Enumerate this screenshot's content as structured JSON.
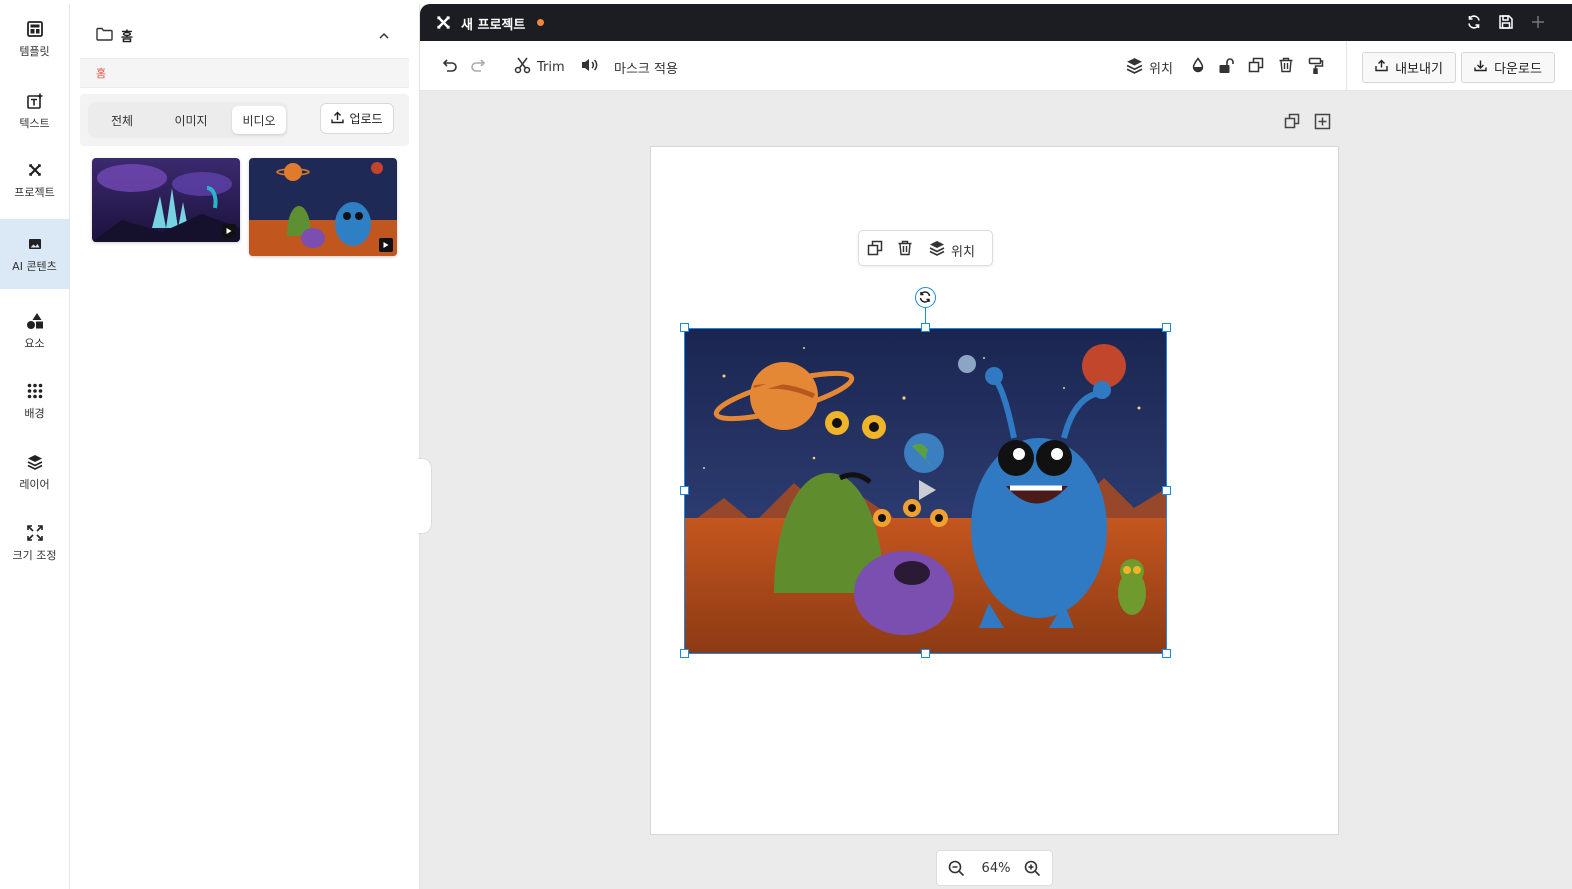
{
  "rail": {
    "items": [
      {
        "label": "템플릿",
        "icon": "template-icon"
      },
      {
        "label": "텍스트",
        "icon": "add-text-icon"
      },
      {
        "label": "프로젝트",
        "icon": "project-icon"
      },
      {
        "label": "AI 콘텐츠",
        "icon": "image-icon"
      },
      {
        "label": "요소",
        "icon": "shapes-icon"
      },
      {
        "label": "배경",
        "icon": "dots-grid-icon"
      },
      {
        "label": "레이어",
        "icon": "layers-icon"
      },
      {
        "label": "크기 조정",
        "icon": "resize-icon"
      }
    ],
    "active_index": 3,
    "active_color": "#dbe9f7"
  },
  "panel": {
    "folder_title": "홈",
    "breadcrumb": "홈",
    "filters": [
      "전체",
      "이미지",
      "비디오"
    ],
    "active_filter": "비디오",
    "upload_label": "업로드"
  },
  "topbar": {
    "title": "새 프로젝트",
    "unsaved_dot_color": "#f5873a"
  },
  "toolbar": {
    "trim_label": "Trim",
    "mask_label": "마스크 적용",
    "position_label": "위치",
    "export_label": "내보내기",
    "download_label": "다운로드"
  },
  "floating_toolbar": {
    "position_label": "위치"
  },
  "zoom": {
    "value": "64%"
  },
  "colors": {
    "accent": "#1e88e5",
    "topbar": "#1b1d22"
  }
}
